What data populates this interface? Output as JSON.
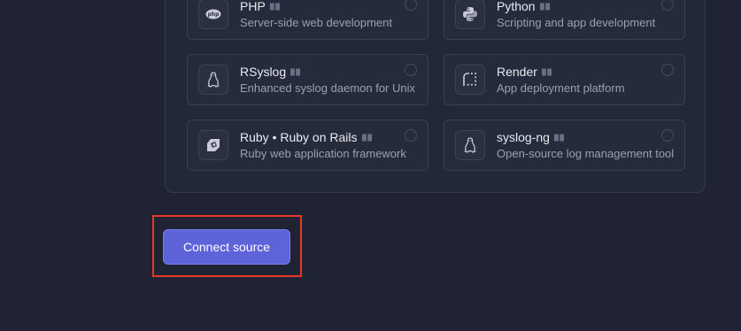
{
  "sources": [
    {
      "name": "PHP",
      "description": "Server-side web development",
      "icon": "php-icon"
    },
    {
      "name": "Python",
      "description": "Scripting and app development",
      "icon": "python-icon"
    },
    {
      "name": "RSyslog",
      "description": "Enhanced syslog daemon for Unix",
      "icon": "linux-penguin-icon"
    },
    {
      "name": "Render",
      "description": "App deployment platform",
      "icon": "render-icon"
    },
    {
      "name": "Ruby • Ruby on Rails",
      "description": "Ruby web application framework",
      "icon": "ruby-icon"
    },
    {
      "name": "syslog-ng",
      "description": "Open-source log management tool",
      "icon": "linux-penguin-icon"
    }
  ],
  "actions": {
    "connect_label": "Connect source"
  },
  "colors": {
    "accent": "#5f63d9",
    "highlight": "#e53923",
    "background": "#1f2333"
  }
}
